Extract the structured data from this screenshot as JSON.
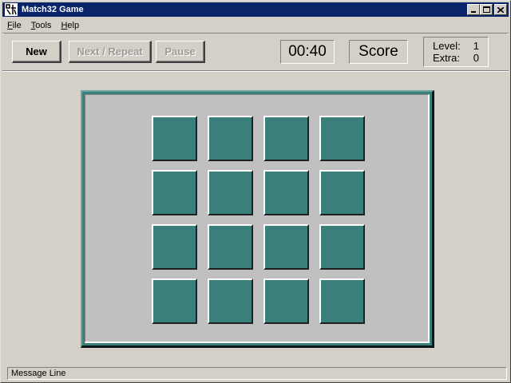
{
  "window": {
    "title": "Match32 Game"
  },
  "menu": [
    {
      "first": "F",
      "rest": "ile"
    },
    {
      "first": "T",
      "rest": "ools"
    },
    {
      "first": "H",
      "rest": "elp"
    }
  ],
  "toolbar": {
    "new_label": "New",
    "next_repeat_label": "Next / Repeat",
    "pause_label": "Pause",
    "timer": "00:40",
    "score_label": "Score",
    "level_label": "Level:",
    "level_value": "1",
    "extra_label": "Extra:",
    "extra_value": "0"
  },
  "board": {
    "rows": 4,
    "cols": 4,
    "tile_color": "#3a7f7a"
  },
  "status": {
    "message": "Message Line"
  },
  "titlebar_buttons": [
    "minimize-icon",
    "maximize-icon",
    "close-icon"
  ]
}
